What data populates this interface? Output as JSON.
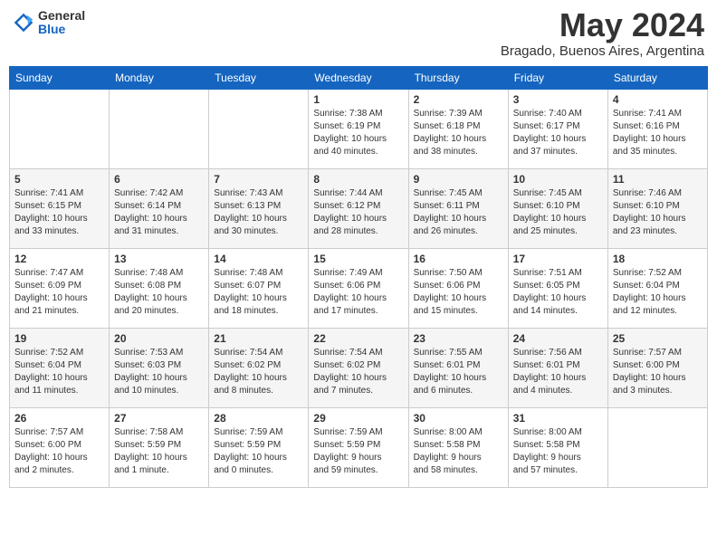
{
  "header": {
    "logo_general": "General",
    "logo_blue": "Blue",
    "month_title": "May 2024",
    "location": "Bragado, Buenos Aires, Argentina"
  },
  "days_of_week": [
    "Sunday",
    "Monday",
    "Tuesday",
    "Wednesday",
    "Thursday",
    "Friday",
    "Saturday"
  ],
  "weeks": [
    [
      {
        "day": "",
        "info": ""
      },
      {
        "day": "",
        "info": ""
      },
      {
        "day": "",
        "info": ""
      },
      {
        "day": "1",
        "info": "Sunrise: 7:38 AM\nSunset: 6:19 PM\nDaylight: 10 hours\nand 40 minutes."
      },
      {
        "day": "2",
        "info": "Sunrise: 7:39 AM\nSunset: 6:18 PM\nDaylight: 10 hours\nand 38 minutes."
      },
      {
        "day": "3",
        "info": "Sunrise: 7:40 AM\nSunset: 6:17 PM\nDaylight: 10 hours\nand 37 minutes."
      },
      {
        "day": "4",
        "info": "Sunrise: 7:41 AM\nSunset: 6:16 PM\nDaylight: 10 hours\nand 35 minutes."
      }
    ],
    [
      {
        "day": "5",
        "info": "Sunrise: 7:41 AM\nSunset: 6:15 PM\nDaylight: 10 hours\nand 33 minutes."
      },
      {
        "day": "6",
        "info": "Sunrise: 7:42 AM\nSunset: 6:14 PM\nDaylight: 10 hours\nand 31 minutes."
      },
      {
        "day": "7",
        "info": "Sunrise: 7:43 AM\nSunset: 6:13 PM\nDaylight: 10 hours\nand 30 minutes."
      },
      {
        "day": "8",
        "info": "Sunrise: 7:44 AM\nSunset: 6:12 PM\nDaylight: 10 hours\nand 28 minutes."
      },
      {
        "day": "9",
        "info": "Sunrise: 7:45 AM\nSunset: 6:11 PM\nDaylight: 10 hours\nand 26 minutes."
      },
      {
        "day": "10",
        "info": "Sunrise: 7:45 AM\nSunset: 6:10 PM\nDaylight: 10 hours\nand 25 minutes."
      },
      {
        "day": "11",
        "info": "Sunrise: 7:46 AM\nSunset: 6:10 PM\nDaylight: 10 hours\nand 23 minutes."
      }
    ],
    [
      {
        "day": "12",
        "info": "Sunrise: 7:47 AM\nSunset: 6:09 PM\nDaylight: 10 hours\nand 21 minutes."
      },
      {
        "day": "13",
        "info": "Sunrise: 7:48 AM\nSunset: 6:08 PM\nDaylight: 10 hours\nand 20 minutes."
      },
      {
        "day": "14",
        "info": "Sunrise: 7:48 AM\nSunset: 6:07 PM\nDaylight: 10 hours\nand 18 minutes."
      },
      {
        "day": "15",
        "info": "Sunrise: 7:49 AM\nSunset: 6:06 PM\nDaylight: 10 hours\nand 17 minutes."
      },
      {
        "day": "16",
        "info": "Sunrise: 7:50 AM\nSunset: 6:06 PM\nDaylight: 10 hours\nand 15 minutes."
      },
      {
        "day": "17",
        "info": "Sunrise: 7:51 AM\nSunset: 6:05 PM\nDaylight: 10 hours\nand 14 minutes."
      },
      {
        "day": "18",
        "info": "Sunrise: 7:52 AM\nSunset: 6:04 PM\nDaylight: 10 hours\nand 12 minutes."
      }
    ],
    [
      {
        "day": "19",
        "info": "Sunrise: 7:52 AM\nSunset: 6:04 PM\nDaylight: 10 hours\nand 11 minutes."
      },
      {
        "day": "20",
        "info": "Sunrise: 7:53 AM\nSunset: 6:03 PM\nDaylight: 10 hours\nand 10 minutes."
      },
      {
        "day": "21",
        "info": "Sunrise: 7:54 AM\nSunset: 6:02 PM\nDaylight: 10 hours\nand 8 minutes."
      },
      {
        "day": "22",
        "info": "Sunrise: 7:54 AM\nSunset: 6:02 PM\nDaylight: 10 hours\nand 7 minutes."
      },
      {
        "day": "23",
        "info": "Sunrise: 7:55 AM\nSunset: 6:01 PM\nDaylight: 10 hours\nand 6 minutes."
      },
      {
        "day": "24",
        "info": "Sunrise: 7:56 AM\nSunset: 6:01 PM\nDaylight: 10 hours\nand 4 minutes."
      },
      {
        "day": "25",
        "info": "Sunrise: 7:57 AM\nSunset: 6:00 PM\nDaylight: 10 hours\nand 3 minutes."
      }
    ],
    [
      {
        "day": "26",
        "info": "Sunrise: 7:57 AM\nSunset: 6:00 PM\nDaylight: 10 hours\nand 2 minutes."
      },
      {
        "day": "27",
        "info": "Sunrise: 7:58 AM\nSunset: 5:59 PM\nDaylight: 10 hours\nand 1 minute."
      },
      {
        "day": "28",
        "info": "Sunrise: 7:59 AM\nSunset: 5:59 PM\nDaylight: 10 hours\nand 0 minutes."
      },
      {
        "day": "29",
        "info": "Sunrise: 7:59 AM\nSunset: 5:59 PM\nDaylight: 9 hours\nand 59 minutes."
      },
      {
        "day": "30",
        "info": "Sunrise: 8:00 AM\nSunset: 5:58 PM\nDaylight: 9 hours\nand 58 minutes."
      },
      {
        "day": "31",
        "info": "Sunrise: 8:00 AM\nSunset: 5:58 PM\nDaylight: 9 hours\nand 57 minutes."
      },
      {
        "day": "",
        "info": ""
      }
    ]
  ]
}
